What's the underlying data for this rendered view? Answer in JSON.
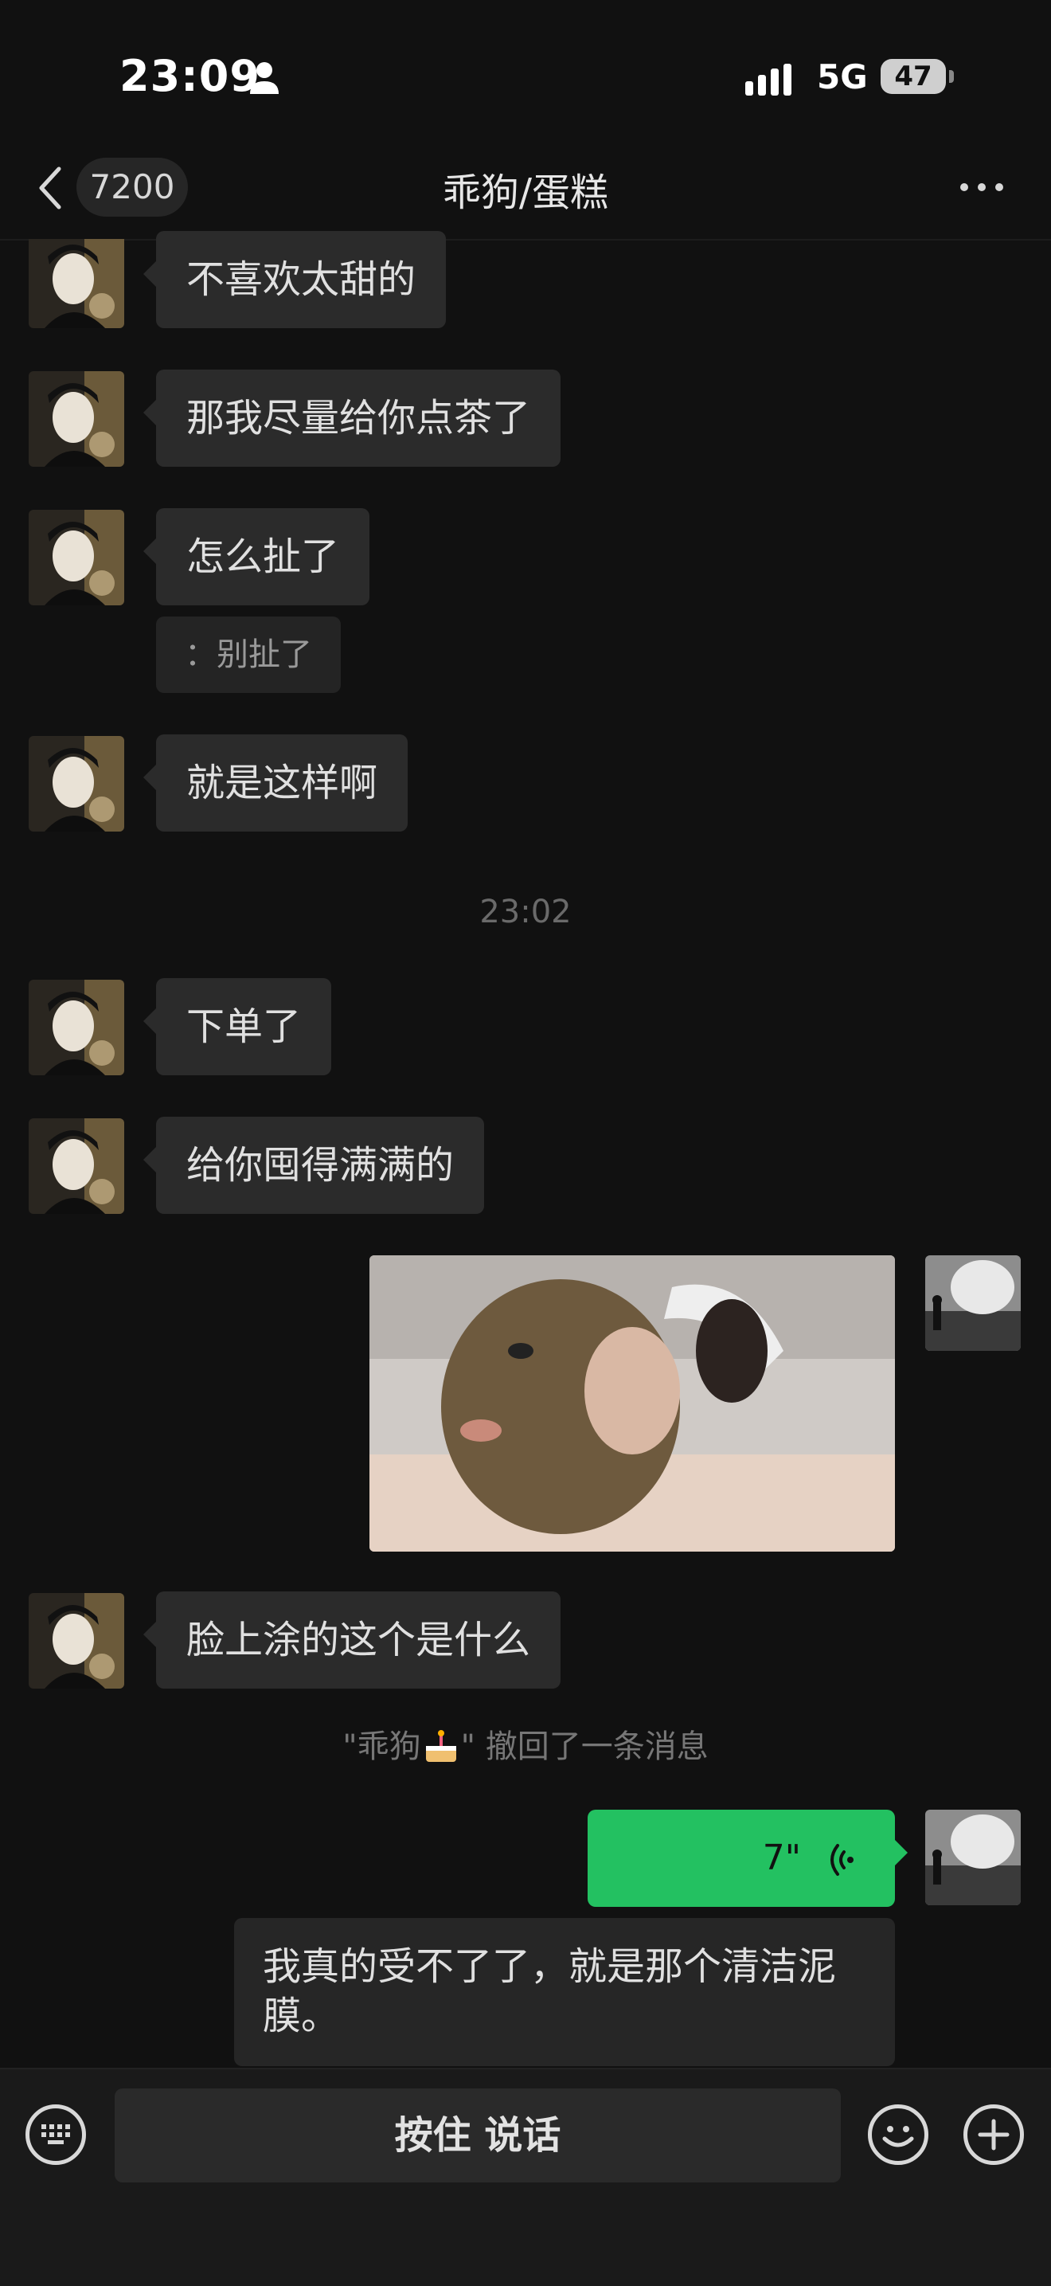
{
  "status_bar": {
    "time": "23:09",
    "network": "5G",
    "battery": "47"
  },
  "nav": {
    "back_count": "7200",
    "title": "乖狗/蛋糕"
  },
  "messages": [
    {
      "type": "incoming",
      "text": "不喜欢太甜的"
    },
    {
      "type": "incoming",
      "text": "那我尽量给你点茶了"
    },
    {
      "type": "incoming",
      "text": "怎么扯了",
      "quote": "：别扯了"
    },
    {
      "type": "incoming",
      "text": "就是这样啊"
    },
    {
      "type": "timestamp",
      "text": "23:02"
    },
    {
      "type": "incoming",
      "text": "下单了"
    },
    {
      "type": "incoming",
      "text": "给你囤得满满的"
    },
    {
      "type": "outgoing-image",
      "icon": "photo"
    },
    {
      "type": "incoming",
      "text": "脸上涂的这个是什么"
    },
    {
      "type": "system",
      "text_before": "\"乖狗",
      "text_after": "\" 撤回了一条消息"
    },
    {
      "type": "outgoing-voice",
      "duration": "7\"",
      "transcript": "我真的受不了了，就是那个清洁泥膜。"
    }
  ],
  "input_bar": {
    "hold_to_talk": "按住 说话"
  },
  "colors": {
    "background": "#111111",
    "incoming_bubble": "#2b2b2b",
    "outgoing_bubble": "#23c161"
  }
}
